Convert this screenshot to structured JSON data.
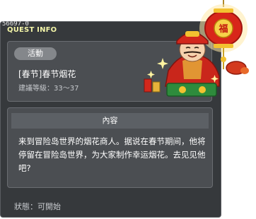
{
  "header": {
    "quest_id": "56697-0",
    "title": "QUEST INFO"
  },
  "quest": {
    "category_badge": "活動",
    "name": "[春节]春节烟花",
    "level_label": "建議等級：",
    "level_range": "33～37"
  },
  "content": {
    "section_title": "內容",
    "description": "来到冒险岛世界的烟花商人。据说在春节期间，他将停留在冒险岛世界，为大家制作幸运烟花。去见见他吧?"
  },
  "footer": {
    "status_label": "狀態：",
    "status_value": "可開始"
  },
  "npc": {
    "icon": "fireworks-merchant-npc",
    "lantern_text": "福"
  },
  "colors": {
    "window_bg": "#36393c",
    "panel_bg": "#4b4e52",
    "header_text": "#f3f5a8",
    "lantern_red": "#d8261a",
    "gold": "#f2c230"
  }
}
